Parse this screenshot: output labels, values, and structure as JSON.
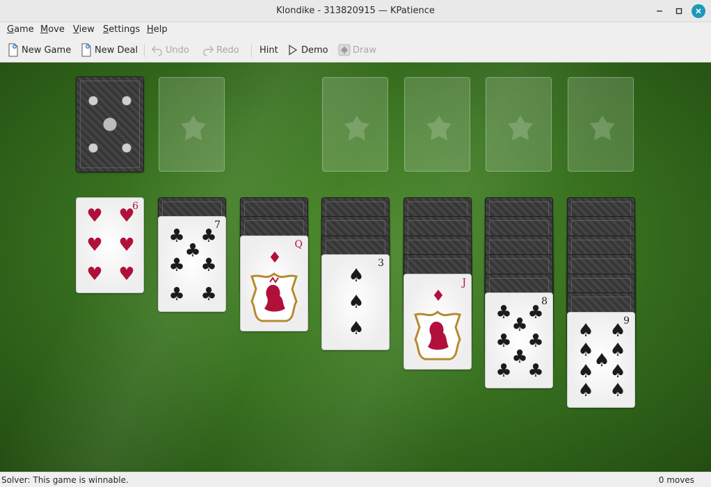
{
  "window": {
    "title": "Klondike - 313820915 — KPatience"
  },
  "menu": [
    {
      "first": "G",
      "rest": "ame"
    },
    {
      "first": "M",
      "rest": "ove"
    },
    {
      "first": "V",
      "rest": "iew"
    },
    {
      "first": "S",
      "rest": "ettings"
    },
    {
      "first": "H",
      "rest": "elp"
    }
  ],
  "toolbar": {
    "new_game": "New Game",
    "new_deal": "New Deal",
    "undo": "Undo",
    "redo": "Redo",
    "hint": "Hint",
    "demo": "Demo",
    "draw": "Draw"
  },
  "colors": {
    "red_suit": "#b0103a",
    "black_suit": "#1b1b1b",
    "felt": "#3a7421",
    "close_button": "#1c9bb6"
  },
  "game": {
    "stock": "face-down",
    "waste": "empty",
    "foundations": [
      "empty",
      "empty",
      "empty",
      "empty"
    ],
    "tableau": [
      {
        "hidden": 0,
        "top": {
          "rank": "6",
          "suit": "hearts"
        }
      },
      {
        "hidden": 1,
        "top": {
          "rank": "7",
          "suit": "clubs"
        }
      },
      {
        "hidden": 2,
        "top": {
          "rank": "Q",
          "suit": "diamonds"
        }
      },
      {
        "hidden": 3,
        "top": {
          "rank": "3",
          "suit": "spades"
        }
      },
      {
        "hidden": 4,
        "top": {
          "rank": "J",
          "suit": "diamonds"
        }
      },
      {
        "hidden": 5,
        "top": {
          "rank": "8",
          "suit": "clubs"
        }
      },
      {
        "hidden": 6,
        "top": {
          "rank": "9",
          "suit": "spades"
        }
      }
    ]
  },
  "status": {
    "solver": "Solver: This game is winnable.",
    "moves": "0 moves"
  }
}
